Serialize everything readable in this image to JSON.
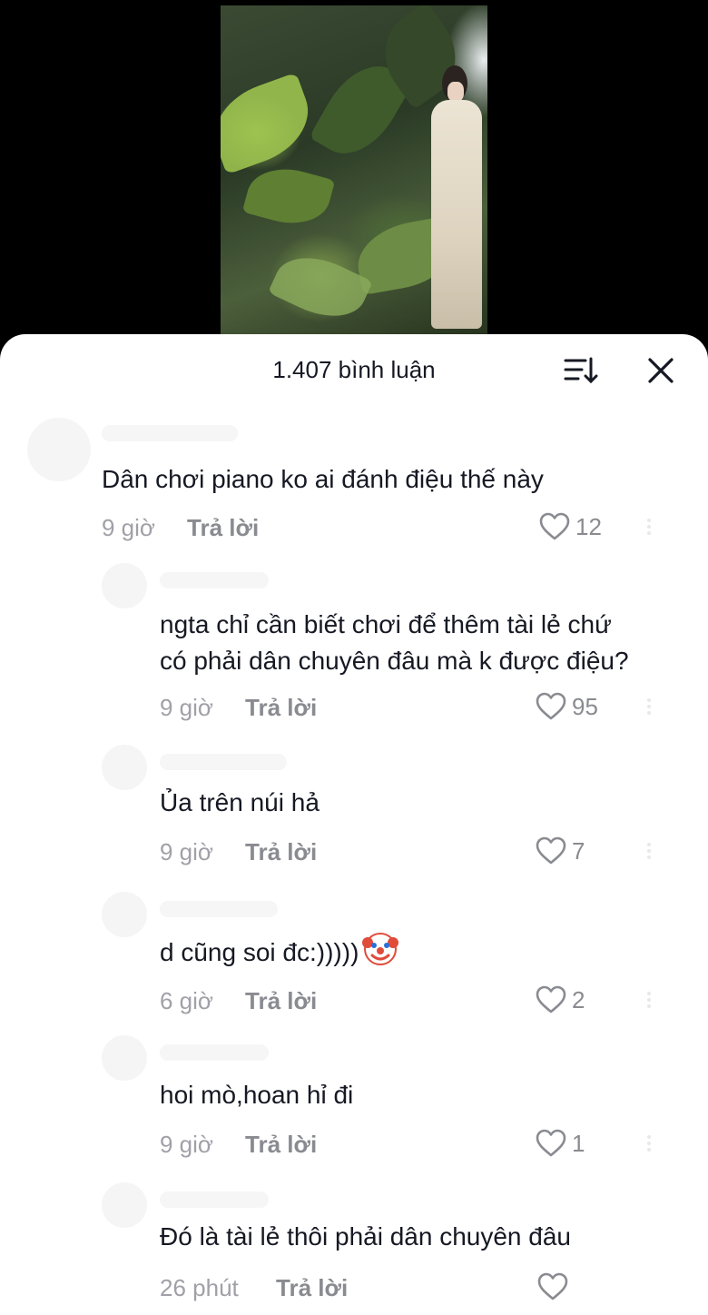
{
  "header": {
    "comment_count_label": "1.407 bình luận"
  },
  "comments": [
    {
      "text": "Dân chơi piano ko ai đánh điệu thế này",
      "time": "9 giờ",
      "reply_label": "Trả lời",
      "likes": "12"
    },
    {
      "text_line1": "ngta chỉ cần biết chơi để thêm tài lẻ chứ",
      "text_line2": "có phải dân chuyên đâu mà k được điệu?",
      "time": "9 giờ",
      "reply_label": "Trả lời",
      "likes": "95"
    },
    {
      "text": "Ủa trên núi hả",
      "time": "9 giờ",
      "reply_label": "Trả lời",
      "likes": "7"
    },
    {
      "text": "d cũng soi đc:)))))",
      "time": "6 giờ",
      "reply_label": "Trả lời",
      "likes": "2"
    },
    {
      "text": "hoi mò,hoan hỉ đi",
      "time": "9 giờ",
      "reply_label": "Trả lời",
      "likes": "1"
    },
    {
      "text": "Đó là tài lẻ thôi phải dân chuyên đâu",
      "time": "26 phút",
      "reply_label": "Trả lời",
      "likes": ""
    }
  ],
  "icons": {
    "sort": "sort-icon",
    "close": "close-icon",
    "like": "heart-icon",
    "emoji": "clown-emoji"
  },
  "colors": {
    "text": "#161823",
    "muted": "#a0a0a8",
    "reply": "#8a8b91"
  }
}
